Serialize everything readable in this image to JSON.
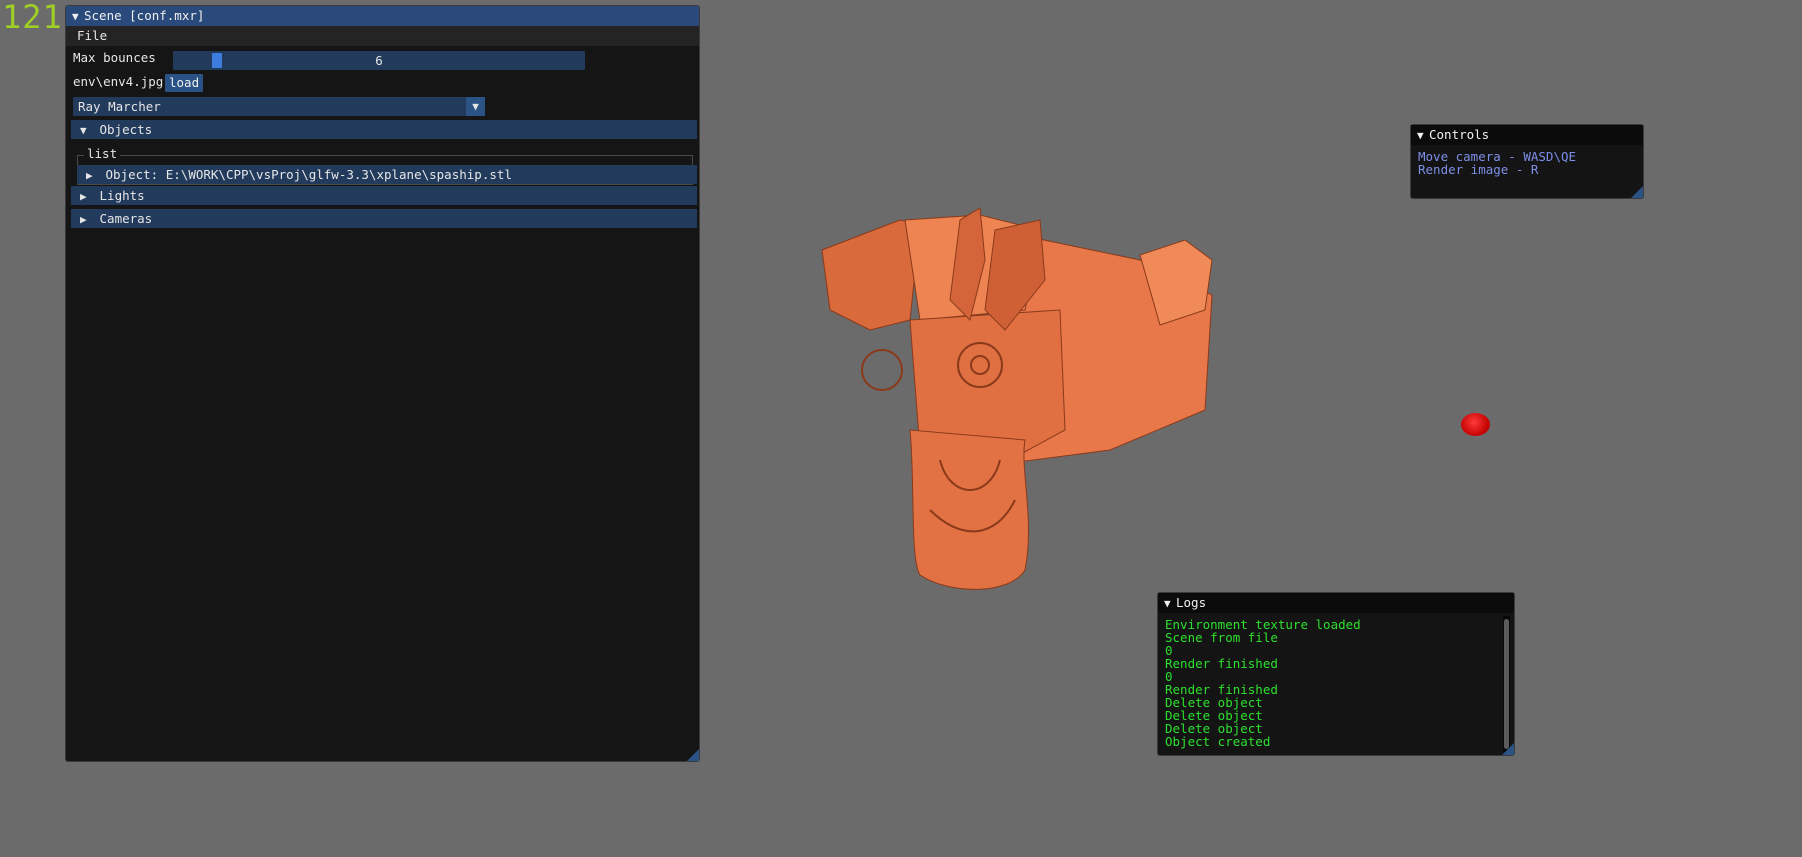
{
  "fps": "121",
  "scene_window": {
    "title": "Scene [conf.mxr]",
    "menu": [
      "File"
    ],
    "max_bounces_label": "Max bounces",
    "max_bounces_value": "6",
    "env_path": "env\\env4.jpg",
    "load_label": "load",
    "renderer": "Ray Marcher",
    "objects_header": "Objects",
    "list_label": "list",
    "object_item": "Object: E:\\WORK\\CPP\\vsProj\\glfw-3.3\\xplane\\spaship.stl",
    "lights_header": "Lights",
    "cameras_header": "Cameras"
  },
  "controls_window": {
    "title": "Controls",
    "lines": [
      "Move camera - WASD\\QE",
      "Render image - R"
    ]
  },
  "logs_window": {
    "title": "Logs",
    "lines": [
      "Environment texture loaded",
      "Scene from file",
      "0",
      "Render finished",
      "0",
      "Render finished",
      "Delete object",
      "Delete object",
      "Delete object",
      "Object created"
    ]
  },
  "colors": {
    "viewport_bg": "#6b6b6b",
    "window_title_active": "#294a7a",
    "header_blue": "#223a5c",
    "fps_green": "#9fcf25",
    "log_green": "#2de02d",
    "controls_text": "#7d8fe6",
    "model_orange": "#e8784a",
    "marker_red": "#e01010"
  },
  "icons": {
    "collapse": "triangle-down-icon",
    "expand": "triangle-right-icon",
    "combo": "triangle-down-icon"
  }
}
